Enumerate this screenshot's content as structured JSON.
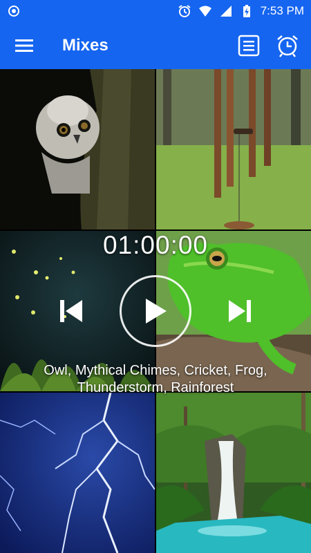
{
  "status_bar": {
    "time": "7:53 PM",
    "icons": [
      "record-icon",
      "alarm-icon",
      "wifi-icon",
      "signal-icon",
      "battery-charging-icon"
    ]
  },
  "app_bar": {
    "title": "Mixes",
    "icons": [
      "hamburger-menu-icon",
      "list-icon",
      "alarm-clock-icon"
    ]
  },
  "tiles": [
    {
      "name": "owl"
    },
    {
      "name": "mythical-chimes"
    },
    {
      "name": "cricket"
    },
    {
      "name": "frog"
    },
    {
      "name": "thunderstorm"
    },
    {
      "name": "rainforest"
    }
  ],
  "player": {
    "timer": "01:00:00",
    "mix_line1": "Owl, Mythical Chimes, Cricket, Frog,",
    "mix_line2": "Thunderstorm, Rainforest",
    "icons": [
      "skip-previous-icon",
      "play-icon",
      "skip-next-icon"
    ]
  },
  "colors": {
    "primary": "#1565f0",
    "text": "#ffffff"
  }
}
